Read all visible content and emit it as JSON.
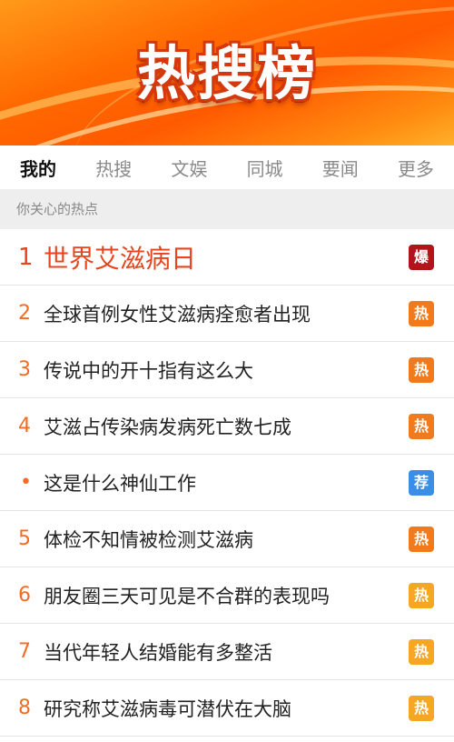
{
  "banner": {
    "title": "热搜榜"
  },
  "tabs": [
    "我的",
    "热搜",
    "文娱",
    "同城",
    "要闻",
    "更多"
  ],
  "active_tab": 0,
  "section_header": "你关心的热点",
  "items": [
    {
      "rank": "1",
      "title": "世界艾滋病日",
      "badge": "爆",
      "badge_type": "explode"
    },
    {
      "rank": "2",
      "title": "全球首例女性艾滋病痊愈者出现",
      "badge": "热",
      "badge_type": "hot1"
    },
    {
      "rank": "3",
      "title": "传说中的开十指有这么大",
      "badge": "热",
      "badge_type": "hot1"
    },
    {
      "rank": "4",
      "title": "艾滋占传染病发病死亡数七成",
      "badge": "热",
      "badge_type": "hot1"
    },
    {
      "rank": "•",
      "title": "这是什么神仙工作",
      "badge": "荐",
      "badge_type": "rec"
    },
    {
      "rank": "5",
      "title": "体检不知情被检测艾滋病",
      "badge": "热",
      "badge_type": "hot1"
    },
    {
      "rank": "6",
      "title": "朋友圈三天可见是不合群的表现吗",
      "badge": "热",
      "badge_type": "hot2"
    },
    {
      "rank": "7",
      "title": "当代年轻人结婚能有多整活",
      "badge": "热",
      "badge_type": "hot2"
    },
    {
      "rank": "8",
      "title": "研究称艾滋病毒可潜伏在大脑",
      "badge": "热",
      "badge_type": "hot2"
    }
  ],
  "colors": {
    "accent": "#f36c21",
    "top_title": "#e8451f",
    "badge_explode": "#b3141b",
    "badge_hot": "#f07a1c",
    "badge_hot_light": "#f5a623",
    "badge_recommend": "#3a8ee6"
  }
}
